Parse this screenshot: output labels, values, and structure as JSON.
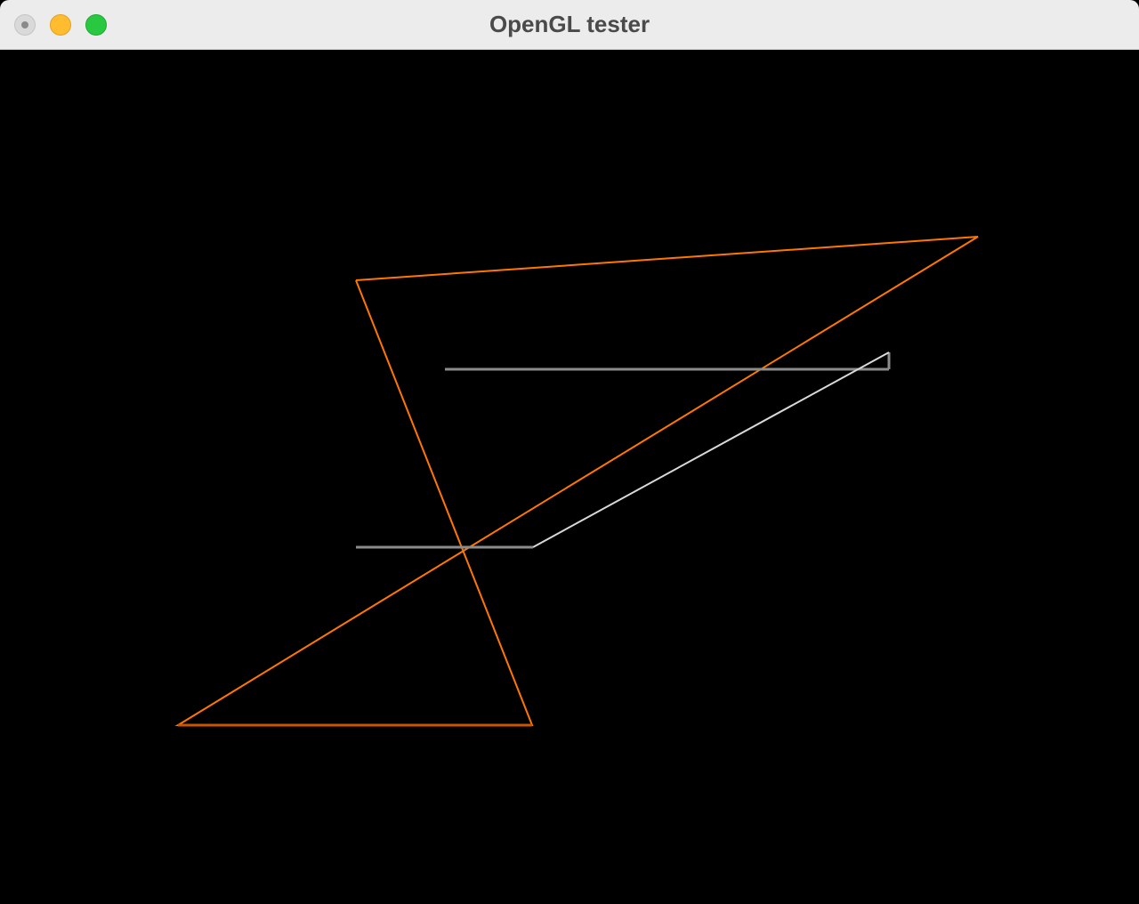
{
  "window": {
    "title": "OpenGL tester"
  },
  "colors": {
    "triangle_stroke": "#ff7700",
    "triangle_bottom_edge": "#cc5500",
    "line_gray": "#8c8c8c",
    "line_light": "#d9d9d9",
    "background": "#000000",
    "titlebar": "#ececec",
    "close": "#d9d9d9",
    "minimize": "#febc2e",
    "zoom": "#28c840"
  },
  "icons": {
    "close": "close-button-icon",
    "minimize": "minimize-button-icon",
    "zoom": "zoom-button-icon"
  }
}
